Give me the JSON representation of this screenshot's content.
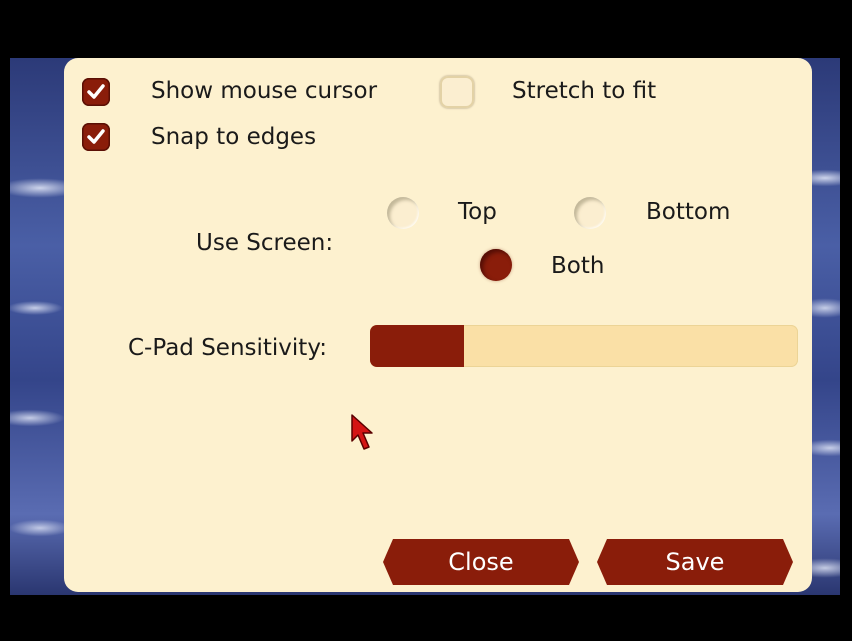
{
  "options": {
    "show_mouse_cursor": {
      "label": "Show mouse cursor",
      "checked": true
    },
    "stretch_to_fit": {
      "label": "Stretch to fit",
      "checked": false
    },
    "snap_to_edges": {
      "label": "Snap to edges",
      "checked": true
    }
  },
  "use_screen": {
    "label": "Use Screen:",
    "options": [
      {
        "label": "Top",
        "selected": false
      },
      {
        "label": "Bottom",
        "selected": false
      },
      {
        "label": "Both",
        "selected": true
      }
    ]
  },
  "sensitivity": {
    "label": "C-Pad Sensitivity:",
    "level_fraction": 0.22
  },
  "buttons": {
    "close": "Close",
    "save": "Save"
  },
  "colors": {
    "panel": "#fdf1cf",
    "accent": "#8a1d0a",
    "slider_track": "#fae0a6",
    "cursor": "#d41414"
  },
  "icons": {
    "checkmark": "checkmark-icon",
    "pointer": "mouse-pointer-icon"
  }
}
